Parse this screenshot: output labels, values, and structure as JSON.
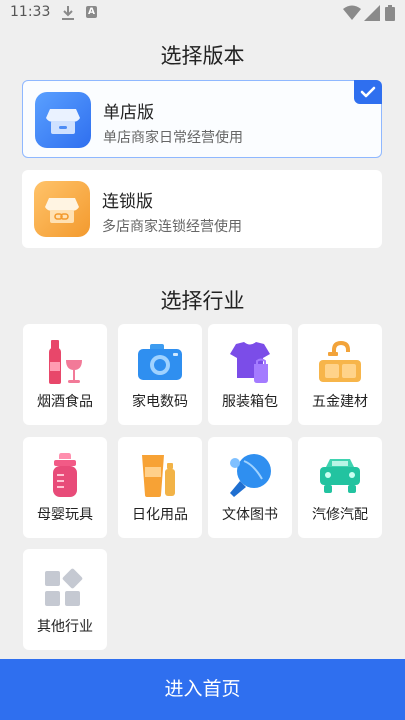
{
  "status_bar": {
    "time": "11:33",
    "icons": [
      "download-icon",
      "a-notification-icon",
      "wifi-icon",
      "signal-icon",
      "battery-icon"
    ]
  },
  "version_section": {
    "title": "选择版本",
    "options": [
      {
        "name": "单店版",
        "desc": "单店商家日常经营使用",
        "selected": true,
        "icon": "store-icon",
        "color": "#3d7bf0"
      },
      {
        "name": "连锁版",
        "desc": "多店商家连锁经营使用",
        "selected": false,
        "icon": "chain-store-icon",
        "color": "#f7a33c"
      }
    ]
  },
  "industry_section": {
    "title": "选择行业",
    "items": [
      {
        "label": "烟酒食品",
        "icon": "wine-bottle-icon"
      },
      {
        "label": "家电数码",
        "icon": "camera-icon"
      },
      {
        "label": "服装箱包",
        "icon": "clothing-bag-icon"
      },
      {
        "label": "五金建材",
        "icon": "faucet-sink-icon"
      },
      {
        "label": "母婴玩具",
        "icon": "baby-bottle-icon"
      },
      {
        "label": "日化用品",
        "icon": "cosmetics-icon"
      },
      {
        "label": "文体图书",
        "icon": "ping-pong-icon"
      },
      {
        "label": "汽修汽配",
        "icon": "car-wrench-icon"
      },
      {
        "label": "其他行业",
        "icon": "other-grid-icon"
      }
    ]
  },
  "enter_button": {
    "label": "进入首页"
  },
  "colors": {
    "accent": "#2f6fef",
    "background": "#efefef"
  }
}
